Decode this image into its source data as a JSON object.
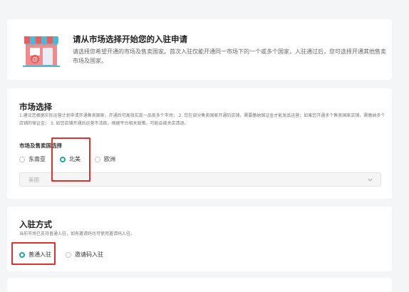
{
  "intro": {
    "icon": "storefront-icon",
    "title": "请从市场选择开始您的入驻申请",
    "description": "请选择您希望开通的市场及售卖国家。首次入驻仅能开通同一市场下的一个或多个国家，入驻通过后，您可选择开通其他售卖市场及国家。"
  },
  "market": {
    "title": "市场选择",
    "note": "1.建议您根据实际运营计划申请开通售卖国家，开通后可高效实现一品卖多个市场； 2. 您在部分售卖国家开通的店铺，需要缴纳保证金才能发品运营；如果您开通多个售卖国家店铺，需缴纳多个店铺的保证金； 3. 如您店铺开通后运营不活跃，根据平台相关政策，可能会被关店清退。",
    "field_label": "市场及售卖国选择",
    "options": [
      "东南亚",
      "北美",
      "欧洲"
    ],
    "selected": "北美",
    "country_value": "美国"
  },
  "join": {
    "title": "入驻方式",
    "note": "当前市场已支持普通入驻，如有邀请码也可使用邀请码入驻。",
    "options": [
      "普通入驻",
      "邀请码入驻"
    ],
    "selected": "普通入驻"
  },
  "colors": {
    "accent": "#1aa99b",
    "highlight": "#e0312b",
    "background": "#f4f5f7"
  }
}
